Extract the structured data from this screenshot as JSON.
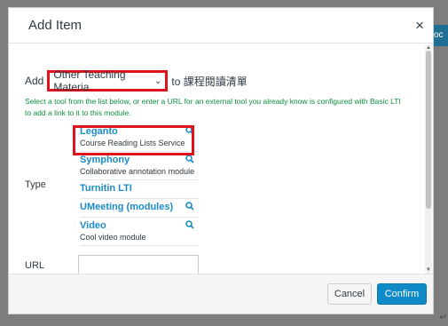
{
  "background": {
    "strip_text": "oc",
    "corner_mark": "↵"
  },
  "modal": {
    "title": "Add Item",
    "close_glyph": "×",
    "add_label": "Add",
    "selected_option": "Other Teaching Materia",
    "chevron_glyph": "⌄",
    "to_text": "to 課程閱讀清單",
    "hint": "Select a tool from the list below, or enter a URL for an external tool you already know is configured with Basic LTI to add a link to it to this module.",
    "type_label": "Type",
    "url_label": "URL",
    "tools": [
      {
        "name": "Leganto",
        "desc": "Course Reading Lists Service",
        "icon": "magnifier-icon"
      },
      {
        "name": "Symphony",
        "desc": "Collaborative annotation module",
        "icon": "magnifier-icon"
      },
      {
        "name": "Turnitin LTI",
        "desc": "",
        "icon": ""
      },
      {
        "name": "UMeeting (modules)",
        "desc": "",
        "icon": "magnifier-icon"
      },
      {
        "name": "Video",
        "desc": "Cool video module",
        "icon": "magnifier-icon"
      }
    ],
    "cancel_label": "Cancel",
    "confirm_label": "Confirm"
  },
  "colors": {
    "accent": "#0e8ac6",
    "link": "#1b8bc7",
    "hint": "#0b8f3e",
    "highlight": "#e0121b"
  }
}
